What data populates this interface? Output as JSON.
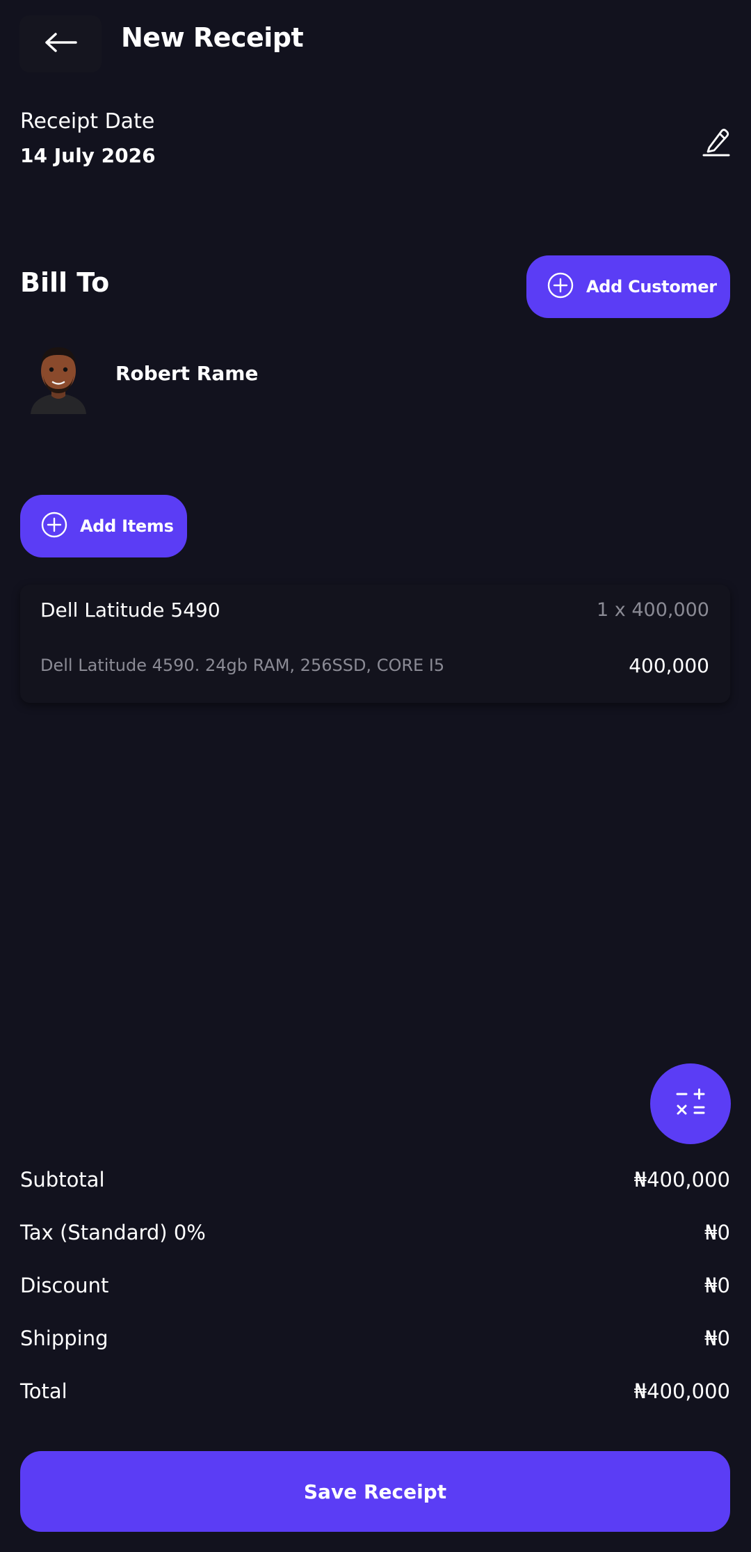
{
  "header": {
    "title": "New Receipt",
    "back_icon": "arrow-left-icon"
  },
  "receipt_date": {
    "label": "Receipt Date",
    "value": "14 July 2026",
    "edit_icon": "pencil-icon"
  },
  "bill_to": {
    "heading": "Bill To",
    "add_customer_label": "Add Customer",
    "customer": {
      "name": "Robert Rame",
      "avatar_icon": "avatar"
    }
  },
  "items": {
    "add_items_label": "Add Items",
    "list": [
      {
        "name": "Dell Latitude 5490",
        "quantity": "1 x 400,000",
        "description": "Dell Latitude 4590. 24gb RAM, 256SSD, CORE I5",
        "amount": "400,000"
      }
    ]
  },
  "calculator_icon": "calculator-icon",
  "totals": {
    "subtotal_label": "Subtotal",
    "subtotal_value": "₦400,000",
    "tax_label": "Tax (Standard) 0%",
    "tax_value": "₦0",
    "discount_label": "Discount",
    "discount_value": "₦0",
    "shipping_label": "Shipping",
    "shipping_value": "₦0",
    "total_label": "Total",
    "total_value": "₦400,000"
  },
  "save_button_label": "Save Receipt",
  "colors": {
    "background": "#12121e",
    "accent": "#5b3df5",
    "muted_text": "#8b8b95"
  }
}
